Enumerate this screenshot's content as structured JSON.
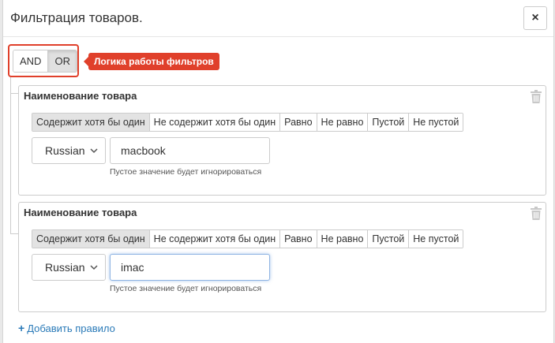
{
  "modal": {
    "title": "Фильтрация товаров.",
    "close_label": "×"
  },
  "logic": {
    "buttons": [
      {
        "label": "AND",
        "active": false
      },
      {
        "label": "OR",
        "active": true
      }
    ],
    "tooltip": "Логика работы фильтров"
  },
  "rules": [
    {
      "title": "Наименование товара",
      "operators": [
        "Содержит хотя бы один",
        "Не содержит хотя бы один",
        "Равно",
        "Не равно",
        "Пустой",
        "Не пустой"
      ],
      "active_operator": "Содержит хотя бы один",
      "language": "Russian",
      "value": "macbook",
      "help": "Пустое значение будет игнорироваться"
    },
    {
      "title": "Наименование товара",
      "operators": [
        "Содержит хотя бы один",
        "Не содержит хотя бы один",
        "Равно",
        "Не равно",
        "Пустой",
        "Не пустой"
      ],
      "active_operator": "Содержит хотя бы один",
      "language": "Russian",
      "value": "imac",
      "help": "Пустое значение будет игнорироваться"
    }
  ],
  "add_rule": {
    "icon": "plus-icon",
    "label": "Добавить правило"
  },
  "colors": {
    "accent_red": "#e0402b",
    "link_blue": "#2a7ab8",
    "active_bg": "#e3e3e3"
  }
}
